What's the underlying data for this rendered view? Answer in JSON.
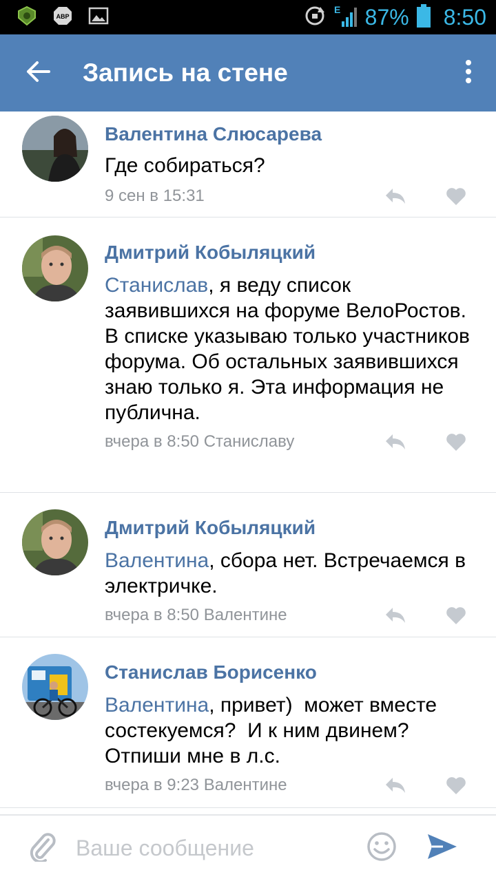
{
  "status_bar": {
    "icons": [
      "shield-app-icon",
      "adblock-abp-icon",
      "image-icon",
      "sync-icon",
      "signal-e-icon",
      "battery-icon"
    ],
    "battery": "87%",
    "network_type": "E",
    "adblock_label": "ABP",
    "time": "8:50"
  },
  "header": {
    "title": "Запись на стене",
    "back_icon": "arrow-left-icon",
    "more_icon": "more-vertical-icon",
    "background": "#5181b8"
  },
  "colors": {
    "accent": "#4b73a4",
    "meta": "#909499",
    "divider": "#dfe2e6"
  },
  "comments": [
    {
      "author": "Валентина Слюсарева",
      "mention": "",
      "text": "Где собираться?",
      "date": "9 сен в 15:31",
      "reply_to": ""
    },
    {
      "author": "Дмитрий Кобыляцкий",
      "mention": "Станислав",
      "text": ", я веду список заявившихся на форуме ВелоРостов. В списке указываю только участников форума. Об остальных заявившихся знаю только я. Эта информация не публична.",
      "date": "вчера в 8:50",
      "reply_to": "Станиславу"
    },
    {
      "author": "Дмитрий Кобыляцкий",
      "mention": "Валентина",
      "text": ", сбора нет. Встречаемся в электричке.",
      "date": "вчера в 8:50",
      "reply_to": "Валентине"
    },
    {
      "author": "Станислав Борисенко",
      "mention": "Валентина",
      "text": ", привет)  может вместе состекуемся?  И к ним двинем? Отпиши мне в л.с.",
      "date": "вчера в 9:23",
      "reply_to": "Валентине"
    }
  ],
  "composer": {
    "placeholder": "Ваше сообщение",
    "attach_icon": "paperclip-icon",
    "emoji_icon": "smiley-icon",
    "send_icon": "send-icon"
  }
}
